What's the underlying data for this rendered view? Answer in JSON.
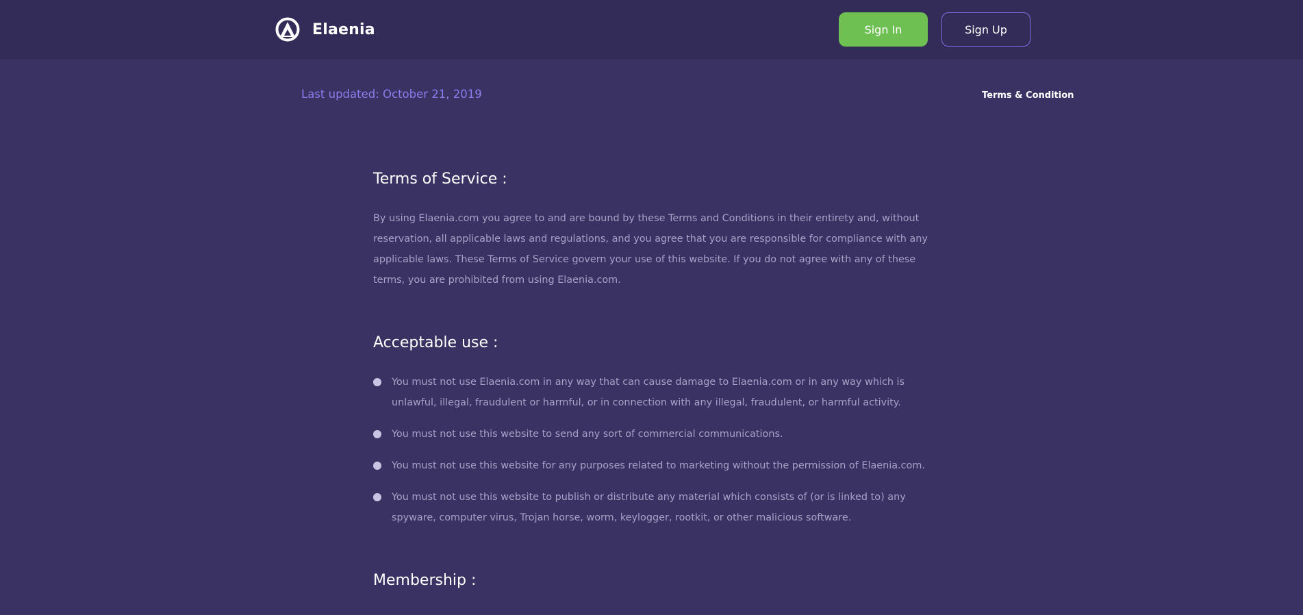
{
  "header": {
    "brand_name": "Elaenia",
    "sign_in_label": "Sign In",
    "sign_up_label": "Sign Up"
  },
  "meta": {
    "last_updated": "Last updated: October 21, 2019",
    "breadcrumb": "Terms & Condition"
  },
  "sections": {
    "terms": {
      "title": "Terms of Service :",
      "body": "By using Elaenia.com you agree to and are bound by these Terms and Conditions in their entirety and, without reservation, all applicable laws and regulations, and you agree that you are responsible for compliance with any applicable laws. These Terms of Service govern your use of this website. If you do not agree with any of these terms, you are prohibited from using Elaenia.com."
    },
    "acceptable_use": {
      "title": "Acceptable use :",
      "items": [
        "You must not use Elaenia.com in any way that can cause damage to Elaenia.com or in any way which is unlawful, illegal, fraudulent or harmful, or in connection with any illegal, fraudulent, or harmful activity.",
        "You must not use this website to send any sort of commercial communications.",
        "You must not use this website for any purposes related to marketing without the permission of Elaenia.com.",
        "You must not use this website to publish or distribute any material which consists of (or is linked to) any spyware, computer virus, Trojan horse, worm, keylogger, rootkit, or other malicious software."
      ]
    },
    "membership": {
      "title": "Membership :"
    }
  },
  "icons": {
    "brand": "brand-logo-icon",
    "bullet": "bullet-dot-icon"
  },
  "colors": {
    "background": "#3a3262",
    "header": "#342c58",
    "accent_green": "#6fc053",
    "accent_purple": "#8b7ef0",
    "body_text": "#a8a1c8"
  }
}
